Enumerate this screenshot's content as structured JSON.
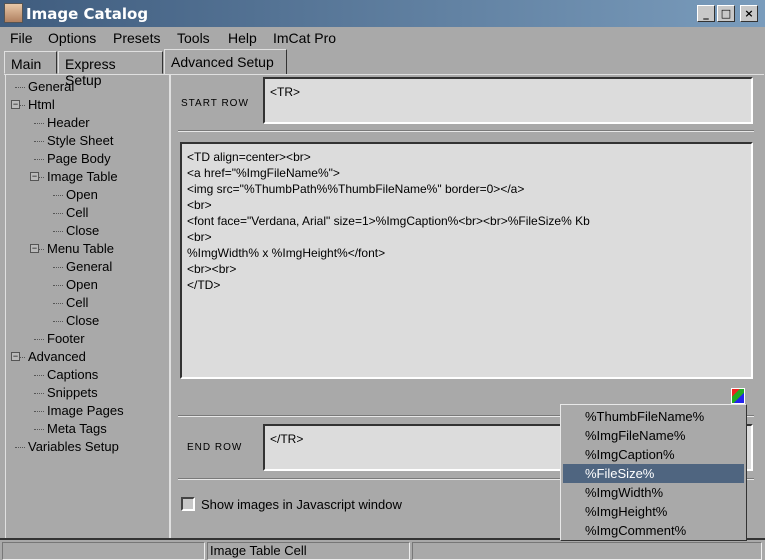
{
  "window": {
    "title": "Image Catalog",
    "controls": [
      "_",
      "□",
      "×"
    ]
  },
  "menu": [
    "File",
    "Options",
    "Presets",
    "Tools",
    "Help",
    "ImCat Pro"
  ],
  "tabs": [
    "Main",
    "Express Setup",
    "Advanced Setup"
  ],
  "tree": [
    {
      "label": "General",
      "level": 0
    },
    {
      "label": "Html",
      "level": 0,
      "expanded": true
    },
    {
      "label": "Header",
      "level": 1
    },
    {
      "label": "Style Sheet",
      "level": 1
    },
    {
      "label": "Page Body",
      "level": 1
    },
    {
      "label": "Image Table",
      "level": 1,
      "expanded": true
    },
    {
      "label": "Open",
      "level": 2
    },
    {
      "label": "Cell",
      "level": 2
    },
    {
      "label": "Close",
      "level": 2
    },
    {
      "label": "Menu Table",
      "level": 1,
      "expanded": true
    },
    {
      "label": "General",
      "level": 2
    },
    {
      "label": "Open",
      "level": 2
    },
    {
      "label": "Cell",
      "level": 2
    },
    {
      "label": "Close",
      "level": 2
    },
    {
      "label": "Footer",
      "level": 1
    },
    {
      "label": "Advanced",
      "level": 0,
      "expanded": true
    },
    {
      "label": "Captions",
      "level": 1
    },
    {
      "label": "Snippets",
      "level": 1
    },
    {
      "label": "Image Pages",
      "level": 1
    },
    {
      "label": "Meta Tags",
      "level": 1
    },
    {
      "label": "Variables Setup",
      "level": 0
    }
  ],
  "start_row": {
    "label": "START ROW",
    "value": "<TR>"
  },
  "cell_html": "<TD align=center><br>\n<a href=\"%ImgFileName%\">\n<img src=\"%ThumbPath%%ThumbFileName%\" border=0></a>\n<br>\n<font face=\"Verdana, Arial\" size=1>%ImgCaption%<br><br>%FileSize% Kb\n<br>\n%ImgWidth% x %ImgHeight%</font>\n<br><br>\n</TD>",
  "end_row": {
    "label": "END ROW",
    "value": "</TR>"
  },
  "checkbox": {
    "label": "Show images in Javascript window",
    "checked": false
  },
  "variables_menu": {
    "items": [
      "%ThumbFileName%",
      "%ImgFileName%",
      "%ImgCaption%",
      "%FileSize%",
      "%ImgWidth%",
      "%ImgHeight%",
      "%ImgComment%"
    ],
    "selected": "%FileSize%"
  },
  "status": [
    "",
    "Image Table Cell",
    ""
  ]
}
